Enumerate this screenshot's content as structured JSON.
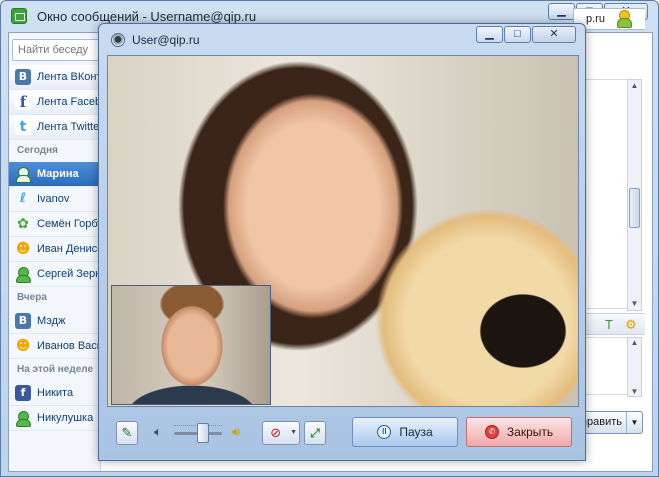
{
  "main_window": {
    "title": "Окно сообщений - Username@qip.ru",
    "controls": {
      "minimize": "▁",
      "maximize": "□",
      "close": "✕"
    },
    "search": {
      "placeholder": "Найти беседу",
      "right_text": "p.ru"
    },
    "sidebar": {
      "feeds": [
        {
          "label": "Лента ВКонтакте",
          "icon": "vk-icon",
          "glyph": "B"
        },
        {
          "label": "Лента Facebook",
          "icon": "facebook-icon",
          "glyph": "f"
        },
        {
          "label": "Лента Twitter",
          "icon": "twitter-icon",
          "glyph": "t"
        }
      ],
      "groups": [
        {
          "header": "Сегодня",
          "items": [
            {
              "label": "Марина",
              "icon": "qip-icon",
              "selected": true
            },
            {
              "label": "Ivanov",
              "icon": "twitter-icon"
            },
            {
              "label": "Семён Горбунков",
              "icon": "icq-icon"
            },
            {
              "label": "Иван Денисов",
              "icon": "jabber-icon"
            },
            {
              "label": "Сергей Зернов",
              "icon": "qip-icon"
            }
          ]
        },
        {
          "header": "Вчера",
          "items": [
            {
              "label": "Мэдж",
              "icon": "vk-icon"
            },
            {
              "label": "Иванов Василий",
              "icon": "jabber-icon"
            }
          ]
        },
        {
          "header": "На этой неделе",
          "items": [
            {
              "label": "Никита",
              "icon": "facebook-icon"
            },
            {
              "label": "Никулушка",
              "icon": "qip-icon"
            }
          ]
        }
      ]
    },
    "send_button": "Отправить"
  },
  "video_window": {
    "title": "User@qip.ru",
    "controls": {
      "minimize": "▁",
      "maximize": "□",
      "close": "✕"
    },
    "volume_level": 0.6,
    "pause_label": "Пауза",
    "close_label": "Закрыть"
  },
  "colors": {
    "selected_item": "#2a6dbd",
    "pause_button": "#a9c8ee",
    "close_button": "#f0a9a9"
  }
}
